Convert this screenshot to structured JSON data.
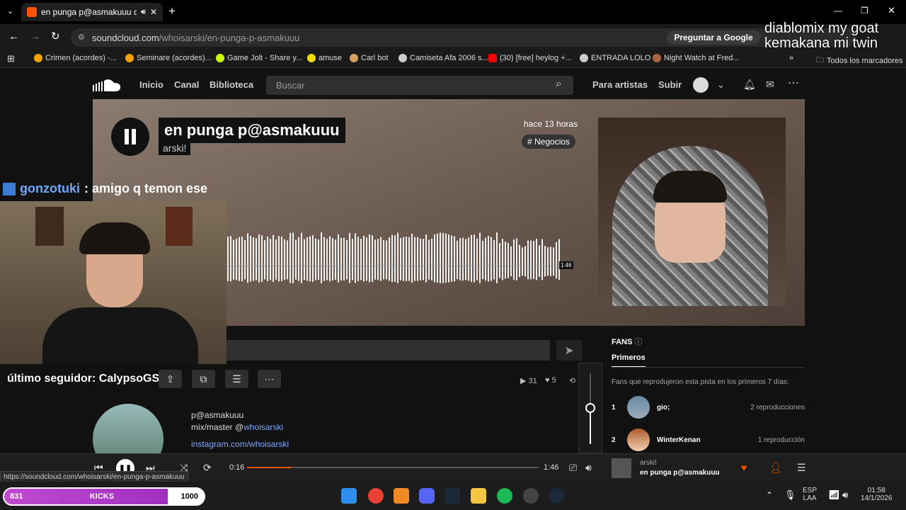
{
  "browser": {
    "tab_title": "en punga p@asmakuuu de",
    "url_host": "soundcloud.com",
    "url_path": "/whoisarski/en-punga-p-asmakuuu",
    "ask_google": "Preguntar a Google",
    "bookmarks": [
      {
        "label": "Crimen (acordes) -...",
        "color": "#f4a300"
      },
      {
        "label": "Seminare (acordes)...",
        "color": "#f4a300"
      },
      {
        "label": "Game Jolt - Share y...",
        "color": "#ccff00"
      },
      {
        "label": "amuse",
        "color": "#f4e000"
      },
      {
        "label": "Carl bot",
        "color": "#d9a066"
      },
      {
        "label": "Camiseta Afa 2006 s...",
        "color": "#cccccc"
      },
      {
        "label": "(30) [free] heylog +...",
        "color": "#ff0000"
      },
      {
        "label": "ENTRADA LOLO",
        "color": "#cccccc"
      },
      {
        "label": "Night Watch at Fred...",
        "color": "#aa6644"
      }
    ],
    "all_bookmarks": "Todos los marcadores",
    "status_url": "https://soundcloud.com/whoisarski/en-punga-p-asmakuuu"
  },
  "overlay_text": {
    "line1": "diablomix my goat",
    "line2": "kemakana mi twin"
  },
  "soundcloud": {
    "nav": {
      "home": "Inicio",
      "feed": "Canal",
      "library": "Biblioteca",
      "search_placeholder": "Buscar",
      "artists": "Para artistas",
      "upload": "Subir"
    },
    "track": {
      "title": "en punga p@asmakuuu",
      "artist": "arski!",
      "posted": "hace 13 horas",
      "tag": "# Negocios",
      "duration_label": "1:46"
    },
    "stats": {
      "plays": "31",
      "likes": "5"
    },
    "fans": {
      "heading": "FANS",
      "tab": "Primeros",
      "description": "Fans que reprodujeron esta pista en los primeros 7 días:",
      "rows": [
        {
          "rank": "1",
          "name": "gio;",
          "plays": "2 reproducciones"
        },
        {
          "rank": "2",
          "name": "WinterKenan",
          "plays": "1 reproducción"
        }
      ]
    },
    "description": {
      "line1": "p@asmakuuu",
      "line2_prefix": "mix/master @",
      "line2_link": "whoisarski",
      "line3": "instagram.com/whoisarski"
    },
    "player": {
      "elapsed": "0:16",
      "total": "1:46",
      "progress": 0.15,
      "artist": "arski!",
      "title": "en punga p@asmakuuu"
    }
  },
  "stream": {
    "chat_user": "gonzotuki",
    "chat_message": ": amigo q temon ese",
    "last_follower": "último seguidor: CalypsoGS",
    "goal_current": "831",
    "goal_label": "KICKS",
    "goal_max": "1000"
  },
  "taskbar": {
    "lang1": "ESP",
    "lang2": "LAA",
    "time": "01:58",
    "date": "14/1/2026"
  },
  "colors": {
    "accent": "#ff5500",
    "chat_user": "#6ea8ff",
    "goal_bar": "#c04ad0"
  }
}
